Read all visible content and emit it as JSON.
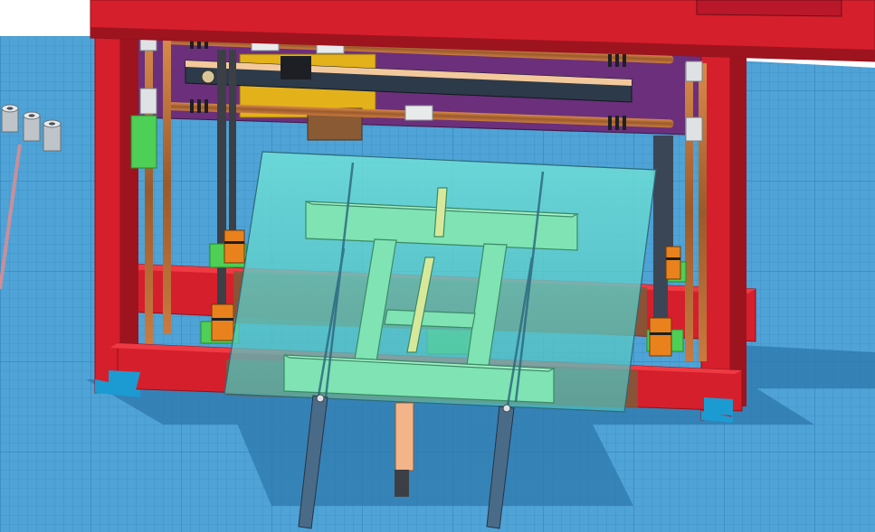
{
  "scene": {
    "type": "3d-cad-workplane",
    "colors": {
      "workplane": "#4fa3d6",
      "grid_minor": "#3b8fc4",
      "grid_major": "#2f7fb6",
      "shadow": "#2e7db3",
      "frame_red": "#d61f2c",
      "frame_red_dark": "#9d141f",
      "frame_red_light": "#ef3a44",
      "purple_plate": "#6b2f7b",
      "copper_rod": "#b5713a",
      "yellow_block": "#e3b21a",
      "bed_glass": "#5fd2cc",
      "bed_frame_green": "#7fe3b3",
      "green_part": "#4ecf55",
      "orange_coupler": "#e9821d",
      "steel": "#cfd3d6",
      "dark_rod": "#3c3f46",
      "peach": "#f3c99c",
      "brown": "#8a5a34"
    },
    "objects": [
      "frame-top-crossbar",
      "frame-left-post",
      "frame-right-post",
      "frame-front-bottom-beam",
      "frame-rear-bottom-beam",
      "x-carriage-plate",
      "x-axis-rods",
      "linear-ruler",
      "z-lead-screws",
      "glass-build-plate",
      "bed-support-frame",
      "z-couplers",
      "loose-spacers",
      "bed-bracket-arms"
    ]
  }
}
